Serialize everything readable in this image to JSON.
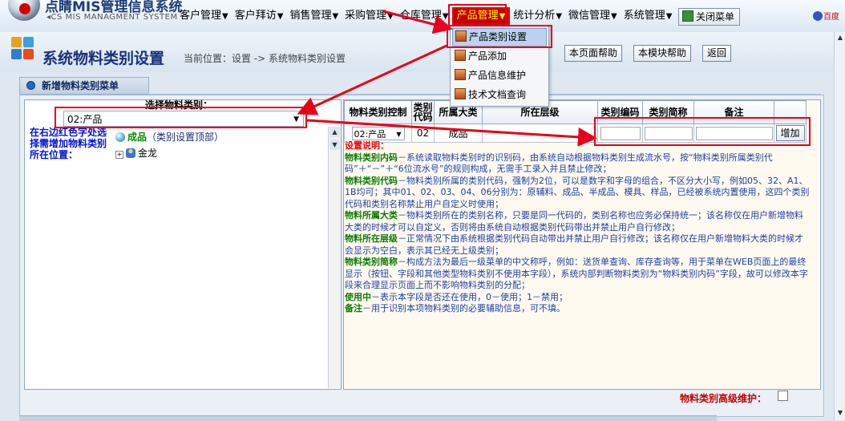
{
  "app": {
    "title": "点睛MIS管理信息系统",
    "subtitle": "CS MIS MANAGMENT SYSTEM"
  },
  "menu": [
    {
      "label": "客户管理"
    },
    {
      "label": "客户拜访"
    },
    {
      "label": "销售管理"
    },
    {
      "label": "采购管理"
    },
    {
      "label": "仓库管理"
    },
    {
      "label": "产品管理"
    },
    {
      "label": "统计分析"
    },
    {
      "label": "微信管理"
    },
    {
      "label": "系统管理"
    }
  ],
  "menu_arrow": "▼",
  "close_menu_label": "关闭菜单",
  "baidu_label": "百度",
  "dropdown": [
    {
      "label": "产品类别设置"
    },
    {
      "label": "产品添加"
    },
    {
      "label": "产品信息维护"
    },
    {
      "label": "技术文档查询"
    }
  ],
  "page": {
    "title": "系统物料类别设置",
    "breadcrumb": "当前位置：设置 -> 系统物料类别设置",
    "help_page": "本页面帮助",
    "help_module": "本模块帮助",
    "back": "返回"
  },
  "panel": {
    "tab_label": "新增物料类别菜单",
    "select_label": "选择物料类别：",
    "select_value": "02:产品",
    "hint": "在右边红色字处选择需增加物料类别所在位置：",
    "tree_root_name": "成品",
    "tree_root_note": "（类别设置顶部）",
    "tree_child": "金龙"
  },
  "grid": {
    "headers": [
      "物料类别控制",
      "类别代码",
      "所属大类",
      "所在层级",
      "类别编码",
      "类别简称",
      "备注",
      ""
    ],
    "row": {
      "control": "02:产品",
      "code": "02",
      "category": "成品",
      "add_label": "增加"
    }
  },
  "description": {
    "heading": "设置说明：",
    "items": [
      {
        "key": "物料类别内码",
        "text": "－系统读取物料类别时的识别码，由系统自动根据物料类别生成流水号，按“物料类别所属类别代码”＋“－”＋“6位流水号”的规则构成，无需手工录入并且禁止修改；"
      },
      {
        "key": "物料类别代码",
        "text": "－物料类别所属的类别代码，强制为2位，可以是数字和字母的组合，不区分大小写，例如05、32、A1、1B均可；其中01、02、03、04、06分别为：原辅料、成品、半成品、模具、样品，已经被系统内置使用，这四个类别代码和类别名称禁止用户自定义时使用；"
      },
      {
        "key": "物料所属大类",
        "text": "－物料类别所在的类别名称，只要是同一代码的，类别名称也应务必保持统一；该名称仅在用户新增物料大类的时候才可以自定义，否则将由系统自动根据类别代码带出并禁止用户自行修改；"
      },
      {
        "key": "物料所在层级",
        "text": "－正常情况下由系统根据类别代码自动带出并禁止用户自行修改；该名称仅在用户新增物料大类的时候才会显示为空白，表示其已经无上级类别；"
      },
      {
        "key": "物料类别简称",
        "text": "－构成方法为最后一级菜单的中文称呼，例如：送货单查询、库存查询等，用于菜单在WEB页面上的最终显示（按钮、字段和其他类型物料类别不使用本字段），系统内部判断物料类别为“物料类别内码”字段，故可以修改本字段来合理显示页面上而不影响物料类别的分配；"
      },
      {
        "key": "使用中",
        "text": "－表示本字段是否还在使用，0－使用；1－禁用；"
      },
      {
        "key": "备注",
        "text": "－用于识别本项物料类别的必要辅助信息，可不填。"
      }
    ]
  },
  "advanced_label": "物料类别高级维护：",
  "colors": {
    "active_menu": "#c00000",
    "highlight_red": "#e8001a",
    "title_blue": "#15327a",
    "hint_blue": "#0013d8",
    "key_green": "#0a7a00"
  }
}
